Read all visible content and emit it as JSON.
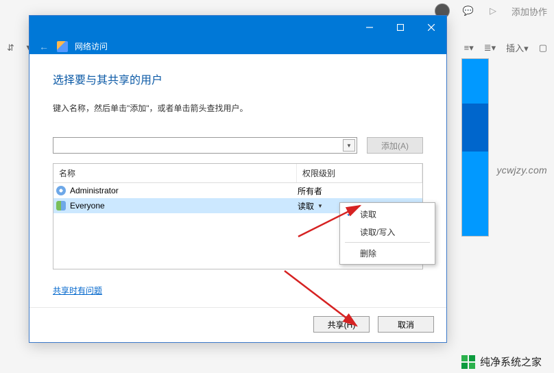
{
  "bg": {
    "add_collab": "添加协作",
    "toolbar2_right": [
      "插入"
    ]
  },
  "dialog": {
    "back_tooltip": "返回",
    "title": "网络访问",
    "heading": "选择要与其共享的用户",
    "instruction": "键入名称，然后单击\"添加\"，或者单击箭头查找用户。",
    "add_button": "添加(A)",
    "columns": {
      "name": "名称",
      "permission": "权限级别"
    },
    "rows": [
      {
        "name": "Administrator",
        "permission": "所有者",
        "selected": false,
        "icon": "single"
      },
      {
        "name": "Everyone",
        "permission": "读取",
        "selected": true,
        "icon": "group",
        "dropdown": true
      }
    ],
    "perm_menu": [
      "读取",
      "读取/写入",
      "删除"
    ],
    "perm_checked_index": 0,
    "trouble_link": "共享时有问题",
    "share_button": "共享(H)",
    "cancel_button": "取消"
  },
  "watermark": "ycwjzy.com",
  "footer_brand": "纯净系统之家"
}
